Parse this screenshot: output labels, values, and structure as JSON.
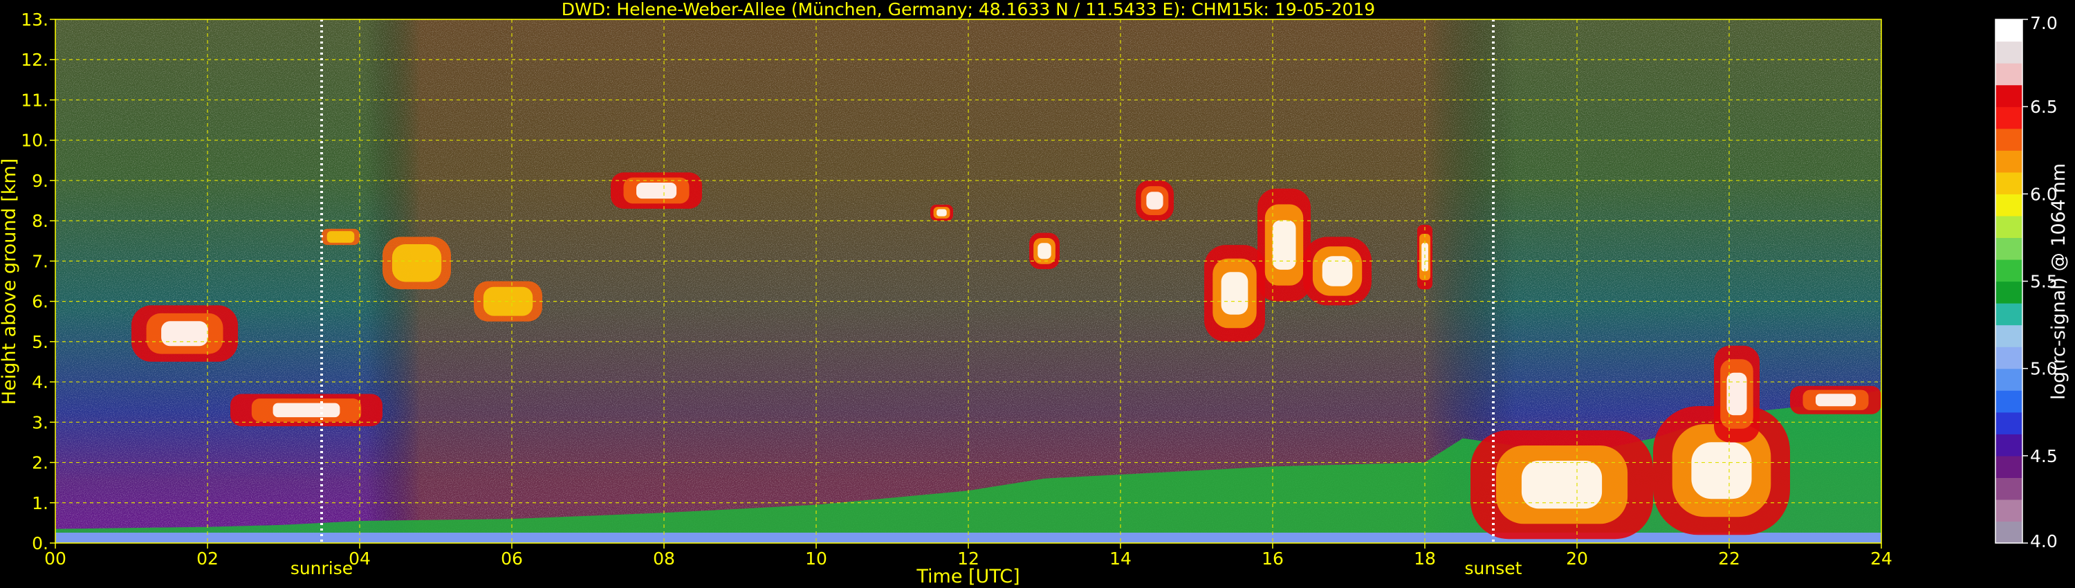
{
  "chart_data": {
    "type": "heatmap",
    "title": "DWD: Helene-Weber-Allee (München, Germany; 48.1633 N / 11.5433 E):    CHM15k: 19-05-2019",
    "xlabel": "Time [UTC]",
    "ylabel": "Height above ground [km]",
    "xlim": [
      0,
      24
    ],
    "ylim": [
      0,
      13
    ],
    "x_ticks": [
      "00",
      "02",
      "04",
      "06",
      "08",
      "10",
      "12",
      "14",
      "16",
      "18",
      "20",
      "22",
      "24"
    ],
    "y_ticks": [
      "0.",
      "1.",
      "2.",
      "3.",
      "4.",
      "5.",
      "6.",
      "7.",
      "8.",
      "9.",
      "10.",
      "11.",
      "12.",
      "13."
    ],
    "grid": true,
    "annotations": [
      {
        "label": "sunrise",
        "x": 3.5
      },
      {
        "label": "sunset",
        "x": 18.9
      }
    ],
    "colorbar": {
      "label": "log(rc-signal) @ 1064 nm",
      "range": [
        4.0,
        7.0
      ],
      "ticks": [
        "4.0",
        "4.5",
        "5.0",
        "5.5",
        "6.0",
        "6.5",
        "7.0"
      ],
      "colors": [
        "#9e93ad",
        "#b07fa5",
        "#8e4a8a",
        "#6b1a82",
        "#4a14a4",
        "#2a38d8",
        "#2a6cf0",
        "#5a94f2",
        "#8eaef2",
        "#9cc6ea",
        "#2ab8a4",
        "#12a02a",
        "#36c03c",
        "#7ad85a",
        "#b4ea3e",
        "#f4f00e",
        "#f8c80a",
        "#f8980a",
        "#f4600e",
        "#f41a12",
        "#e0080e",
        "#f0c0c2",
        "#e6dcde",
        "#ffffff"
      ]
    },
    "layers": {
      "boundary_layer_top": [
        [
          0,
          0.35
        ],
        [
          2,
          0.4
        ],
        [
          3,
          0.45
        ],
        [
          4,
          0.55
        ],
        [
          6,
          0.6
        ],
        [
          8,
          0.75
        ],
        [
          10,
          0.95
        ],
        [
          12,
          1.3
        ],
        [
          13,
          1.6
        ],
        [
          14,
          1.7
        ],
        [
          16,
          1.9
        ],
        [
          18,
          2.0
        ],
        [
          18.5,
          2.6
        ],
        [
          20,
          2.2
        ],
        [
          21,
          2.6
        ],
        [
          22,
          3.2
        ],
        [
          23,
          3.4
        ],
        [
          24,
          3.8
        ]
      ],
      "cloud_layers": [
        {
          "x0": 1.0,
          "x1": 2.4,
          "bottom": 4.5,
          "top": 5.9,
          "level": "high"
        },
        {
          "x0": 2.3,
          "x1": 4.3,
          "bottom": 2.9,
          "top": 3.7,
          "level": "high"
        },
        {
          "x0": 3.5,
          "x1": 4.0,
          "bottom": 7.4,
          "top": 7.8,
          "level": "med"
        },
        {
          "x0": 4.3,
          "x1": 5.2,
          "bottom": 6.3,
          "top": 7.6,
          "level": "med"
        },
        {
          "x0": 5.5,
          "x1": 6.4,
          "bottom": 5.5,
          "top": 6.5,
          "level": "med"
        },
        {
          "x0": 7.3,
          "x1": 8.5,
          "bottom": 8.3,
          "top": 9.2,
          "level": "high"
        },
        {
          "x0": 11.5,
          "x1": 11.8,
          "bottom": 8.0,
          "top": 8.4,
          "level": "peak"
        },
        {
          "x0": 12.8,
          "x1": 13.2,
          "bottom": 6.8,
          "top": 7.7,
          "level": "peak"
        },
        {
          "x0": 14.2,
          "x1": 14.7,
          "bottom": 8.0,
          "top": 9.0,
          "level": "high"
        },
        {
          "x0": 15.1,
          "x1": 15.9,
          "bottom": 5.0,
          "top": 7.4,
          "level": "peak"
        },
        {
          "x0": 15.8,
          "x1": 16.5,
          "bottom": 6.0,
          "top": 8.8,
          "level": "peak"
        },
        {
          "x0": 16.4,
          "x1": 17.3,
          "bottom": 5.9,
          "top": 7.6,
          "level": "peak"
        },
        {
          "x0": 17.9,
          "x1": 18.1,
          "bottom": 6.3,
          "top": 7.9,
          "level": "peak"
        },
        {
          "x0": 18.6,
          "x1": 21.0,
          "bottom": 0.1,
          "top": 2.8,
          "level": "peak"
        },
        {
          "x0": 21.0,
          "x1": 22.8,
          "bottom": 0.2,
          "top": 3.4,
          "level": "peak"
        },
        {
          "x0": 21.8,
          "x1": 22.4,
          "bottom": 2.5,
          "top": 4.9,
          "level": "high"
        },
        {
          "x0": 22.8,
          "x1": 24.0,
          "bottom": 3.2,
          "top": 3.9,
          "level": "high"
        }
      ]
    }
  }
}
